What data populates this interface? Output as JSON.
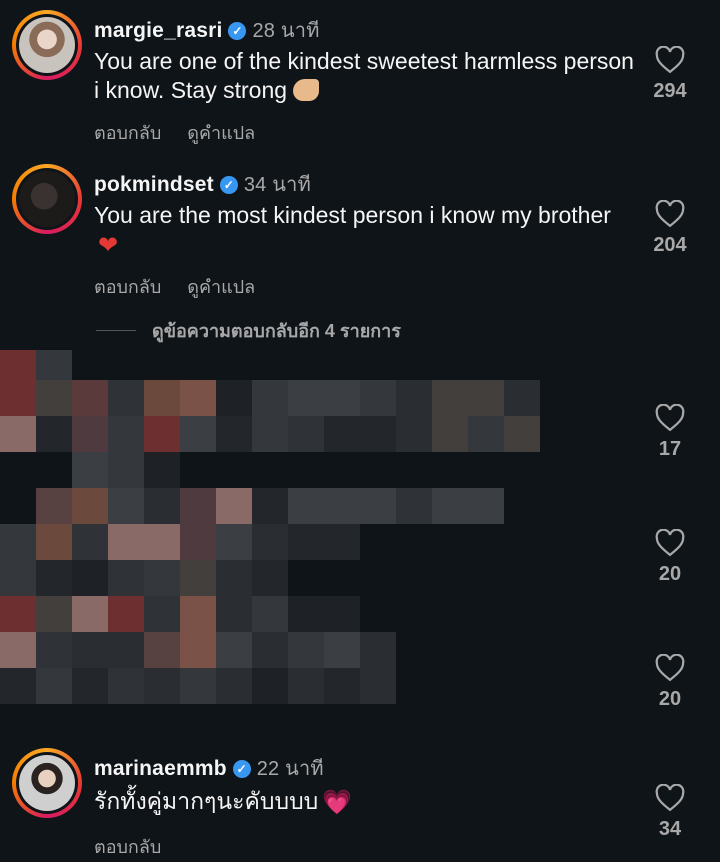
{
  "comments": [
    {
      "username": "margie_rasri",
      "time": "28 นาที",
      "text": "You are one of the kindest sweetest harmless person i know. Stay strong",
      "reply": "ตอบกลับ",
      "translate": "ดูคำแปล",
      "likes": "294",
      "emoji": "flexed-biceps"
    },
    {
      "username": "pokmindset",
      "time": "34 นาที",
      "text": "You are the most kindest person i know my brother",
      "reply": "ตอบกลับ",
      "translate": "ดูคำแปล",
      "likes": "204",
      "emoji": "red-heart"
    },
    {
      "username": "marinaemmb",
      "time": "22 นาที",
      "text": "รักทั้งคู่มากๆนะคับบบบ",
      "reply": "ตอบกลับ",
      "likes": "34",
      "emoji": "sparkling-heart"
    }
  ],
  "view_replies": "ดูข้อความตอบกลับอีก 4 รายการ",
  "hidden_comments_likes": [
    "17",
    "20",
    "20"
  ],
  "colors": {
    "background": "#0f1419",
    "text": "#f5f5f5",
    "muted": "#a8a8a8",
    "verified": "#3897f0"
  }
}
